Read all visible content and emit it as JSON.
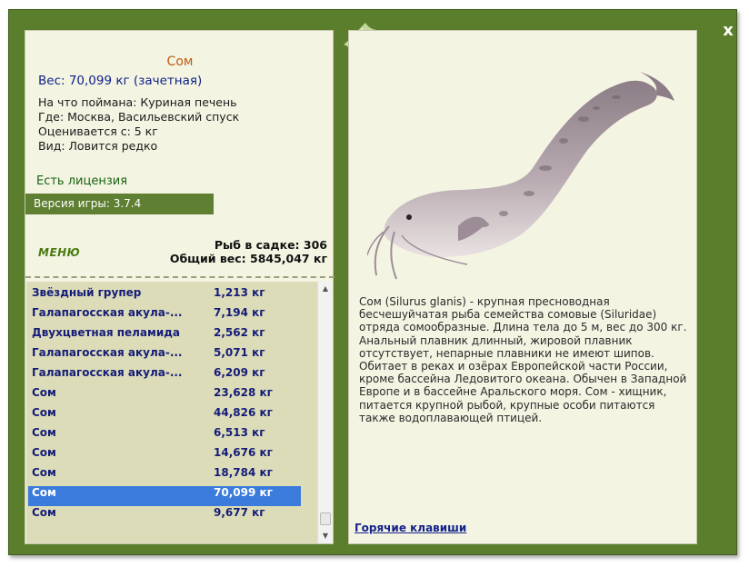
{
  "window": {
    "close_label": "x",
    "colors": {
      "frame": "#5a7e2c",
      "panel": "#f4f4e3",
      "list": "#dcdcb8",
      "selection": "#3b7bdc",
      "name": "#c05a10",
      "weight": "#0b1f86"
    }
  },
  "fish": {
    "name": "Сом",
    "weight": "Вес: 70,099 кг (зачетная)",
    "caught_on": "На что поймана: Куриная печень",
    "place": "Где: Москва, Васильевский спуск",
    "price": "Оценивается с: 5 кг",
    "rarity": "Вид: Ловится редко",
    "image_icon": "catfish-illustration",
    "description": "Сом (Silurus glanis) - крупная пресноводная бесчешуйчатая рыба семейства сомовые (Siluridae) отряда сомообразные. Длина тела до 5 м, вес до 300 кг. Анальный плавник длинный, жировой плавник отсутствует, непарные плавники не имеют шипов. Обитает в реках и озёрах Европейской части России, кроме бассейна Ледовитого океана. Обычен в Западной Европе и в бассейне Аральского моря. Сом - хищник, питается крупной рыбой, крупные особи питаются также водоплавающей птицей."
  },
  "license": "Есть лицензия",
  "version": "Версия игры: 3.7.4",
  "menu_label": "МЕНЮ",
  "cage": {
    "count_label": "Рыб в садке: 306",
    "total_label": "Общий вес: 5845,047 кг"
  },
  "catches": [
    {
      "name": "Звёздный групер",
      "weight": "1,213 кг",
      "selected": false
    },
    {
      "name": "Галапагосская акула-...",
      "weight": "7,194 кг",
      "selected": false
    },
    {
      "name": "Двухцветная пеламида",
      "weight": "2,562 кг",
      "selected": false
    },
    {
      "name": "Галапагосская акула-...",
      "weight": "5,071 кг",
      "selected": false
    },
    {
      "name": "Галапагосская акула-...",
      "weight": "6,209 кг",
      "selected": false
    },
    {
      "name": "Сом",
      "weight": "23,628 кг",
      "selected": false
    },
    {
      "name": "Сом",
      "weight": "44,826 кг",
      "selected": false
    },
    {
      "name": "Сом",
      "weight": "6,513 кг",
      "selected": false
    },
    {
      "name": "Сом",
      "weight": "14,676 кг",
      "selected": false
    },
    {
      "name": "Сом",
      "weight": "18,784 кг",
      "selected": false
    },
    {
      "name": "Сом",
      "weight": "70,099 кг",
      "selected": true
    },
    {
      "name": "Сом",
      "weight": "9,677 кг",
      "selected": false
    }
  ],
  "hotkeys_label": "Горячие клавиши"
}
